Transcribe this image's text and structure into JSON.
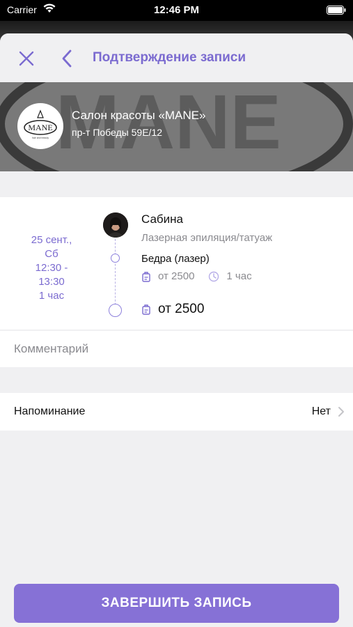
{
  "status_bar": {
    "carrier": "Carrier",
    "time": "12:46 PM"
  },
  "nav": {
    "title": "Подтверждение записи",
    "close_icon": "close-icon",
    "back_icon": "chevron-left-icon"
  },
  "salon": {
    "name": "Салон красоты «MANE»",
    "address": "пр-т Победы 59Е/12",
    "logo_text": "MANE"
  },
  "appointment": {
    "date_line1": "25 сент.,",
    "date_line2": "Сб",
    "time_line1": "12:30 -",
    "time_line2": "13:30",
    "duration": "1 час",
    "master_name": "Сабина",
    "master_role": "Лазерная эпиляция/татуаж",
    "service_name": "Бедра (лазер)",
    "service_price": "от 2500",
    "service_duration": "1 час",
    "total_price": "от 2500"
  },
  "comment": {
    "placeholder": "Комментарий",
    "value": ""
  },
  "reminder": {
    "label": "Напоминание",
    "value": "Нет"
  },
  "submit": {
    "label": "ЗАВЕРШИТЬ ЗАПИСЬ"
  },
  "colors": {
    "accent": "#7b6bd0",
    "button": "#8671d6",
    "background": "#f0f0f2"
  }
}
